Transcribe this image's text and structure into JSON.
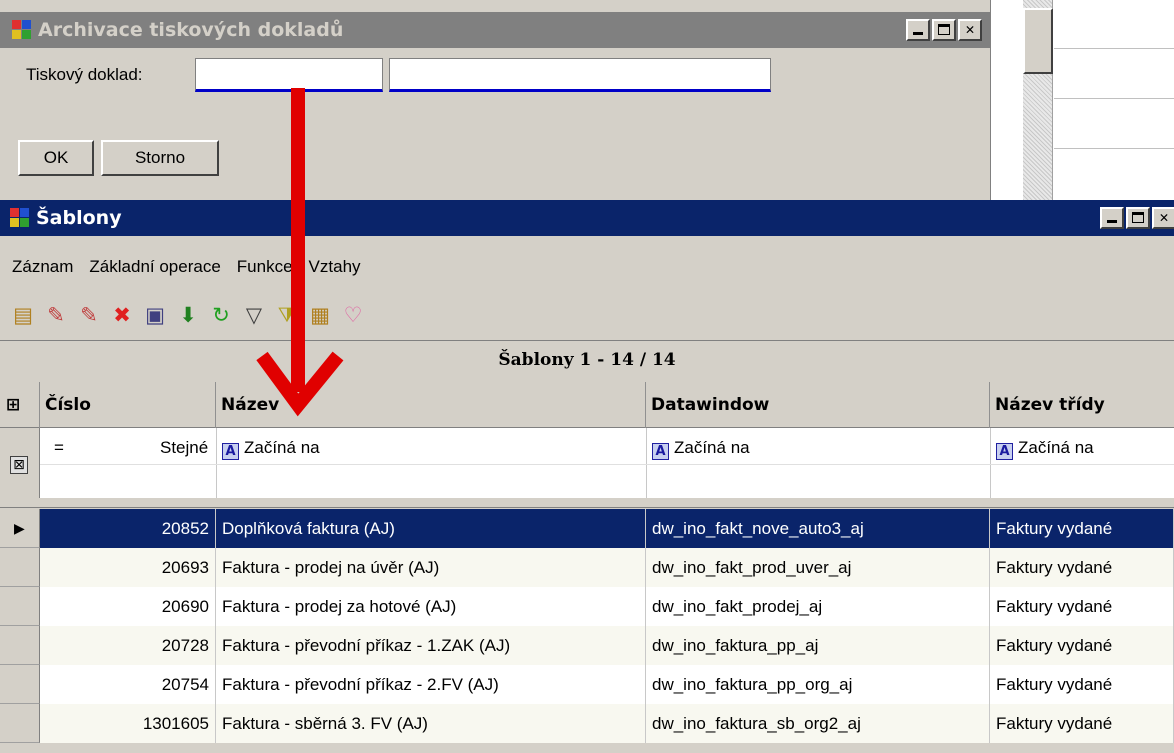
{
  "dialog": {
    "title": "Archivace tiskových dokladů",
    "doc_label": "Tiskový doklad:",
    "doc_field_1": "",
    "doc_field_2": "",
    "ok_label": "OK",
    "storno_label": "Storno",
    "minimize_icon": "minimize-icon",
    "maximize_icon": "maximize-icon",
    "close_icon": "close-icon"
  },
  "window": {
    "title": "Šablony",
    "menu": [
      "Záznam",
      "Základní operace",
      "Funkce",
      "Vztahy"
    ],
    "toolbar_icons": [
      "new-record-icon",
      "edit-record-icon",
      "edit-copy-icon",
      "delete-icon",
      "print-icon",
      "down-arrow-icon",
      "refresh-icon",
      "filter-icon",
      "filter-advanced-icon",
      "folder-icon",
      "link-icon"
    ],
    "grid_caption": "Šablony  1 - 14 / 14",
    "columns": [
      "Číslo",
      "Název",
      "Datawindow",
      "Název třídy"
    ],
    "filter": {
      "cislo_op": "=",
      "cislo_mode": "Stejné",
      "nazev_mode": "Začíná na",
      "datawindow_mode": "Začíná na",
      "trida_mode": "Začíná na"
    },
    "rows": [
      {
        "cislo": "20852",
        "nazev": "Doplňková faktura (AJ)",
        "datawindow": "dw_ino_fakt_nove_auto3_aj",
        "trida": "Faktury vydané"
      },
      {
        "cislo": "20693",
        "nazev": "Faktura - prodej na úvěr (AJ)",
        "datawindow": "dw_ino_fakt_prod_uver_aj",
        "trida": "Faktury vydané"
      },
      {
        "cislo": "20690",
        "nazev": "Faktura - prodej za hotové (AJ)",
        "datawindow": "dw_ino_fakt_prodej_aj",
        "trida": "Faktury vydané"
      },
      {
        "cislo": "20728",
        "nazev": "Faktura - převodní příkaz - 1.ZAK (AJ)",
        "datawindow": "dw_ino_faktura_pp_aj",
        "trida": "Faktury vydané"
      },
      {
        "cislo": "20754",
        "nazev": "Faktura - převodní příkaz - 2.FV (AJ)",
        "datawindow": "dw_ino_faktura_pp_org_aj",
        "trida": "Faktury vydané"
      },
      {
        "cislo": "1301605",
        "nazev": "Faktura - sběrná 3. FV  (AJ)",
        "datawindow": "dw_ino_faktura_sb_org2_aj",
        "trida": "Faktury vydané"
      }
    ]
  },
  "colors": {
    "active_title": "#0a246a",
    "inactive_title": "#808080",
    "selection": "#0a246a",
    "annotation_arrow": "#e00000"
  }
}
